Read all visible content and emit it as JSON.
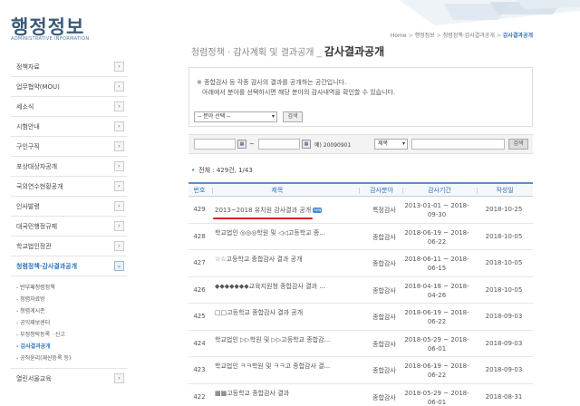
{
  "sidebar": {
    "title": "행정정보",
    "subtitle": "ADMINISTRATIVE INFORMATION",
    "items_top": [
      {
        "label": "정책자료"
      },
      {
        "label": "업무협약(MOU)"
      },
      {
        "label": "세소식"
      },
      {
        "label": "시험안내"
      },
      {
        "label": "구인구직"
      },
      {
        "label": "포상대상자공개"
      },
      {
        "label": "국외연수현황공개"
      },
      {
        "label": "인사발령"
      },
      {
        "label": "대국민행정규제"
      },
      {
        "label": "학교법인정관"
      }
    ],
    "active_item": {
      "label": "청렴정책·감사결과공개"
    },
    "submenu": [
      {
        "label": "- 반부패청렴정책"
      },
      {
        "label": "- 청렴자료방"
      },
      {
        "label": "- 청렴게시존"
      },
      {
        "label": "- 공익제보센터"
      },
      {
        "label": "- 부정청탁등록 · 신고"
      },
      {
        "label": "- 감사결과공개"
      },
      {
        "label": "- 공직윤리(재산등록 등)"
      }
    ],
    "active_sub_index": 5,
    "last_item": {
      "label": "열린서울교육"
    }
  },
  "breadcrumb": {
    "home": "Home",
    "level1": "행정정보",
    "level2": "청렴정책·감사결과공개",
    "current": "감사결과공개",
    "separator": ">"
  },
  "page": {
    "title_prefix": "청렴정책 · 감사계획 및 결과공개 _",
    "title": "감사결과공개"
  },
  "info": {
    "line1": "※ 종합감사 등 각종 감사의 결과를 공개하는 공간입니다.",
    "line2": "아래에서 분야를 선택하시면 해당 분야의 감사내역을 확인할 수 있습니다.",
    "select_value": "-- 분야 선택 --",
    "search_label": "검색"
  },
  "search_bar": {
    "date_from": "",
    "date_to": "",
    "tilde": "~",
    "example": "예) 20090901",
    "type_value": "제목",
    "keyword": "",
    "search_label": "검색"
  },
  "total": {
    "bullet": "•",
    "text": "전체 : 429건, 1/43"
  },
  "table": {
    "headers": [
      "번호",
      "제목",
      "감사분야",
      "감사기간",
      "작성일"
    ],
    "rows": [
      {
        "no": "429",
        "title": "2013~2018 유치원 감사결과 공개",
        "badge": "new",
        "field": "특정감사",
        "period_1": "2013-01-01 ~ 2018-",
        "period_2": "09-30",
        "date": "2018-10-25"
      },
      {
        "no": "428",
        "title": "학교법인 ◎◎◎학원 및 ◁◁고등학교 종...",
        "field": "종합감사",
        "period_1": "2018-06-19 ~ 2018-",
        "period_2": "06-22",
        "date": "2018-10-05"
      },
      {
        "no": "427",
        "title": "☆☆고등학교 종합감사 결과 공개",
        "field": "종합감사",
        "period_1": "2018-06-11 ~ 2018-",
        "period_2": "06-15",
        "date": "2018-10-05"
      },
      {
        "no": "426",
        "title": "◆◆◆◆◆◆◆교육지원청 종합감사 결과 ...",
        "field": "종합감사",
        "period_1": "2018-04-18 ~ 2018-",
        "period_2": "04-26",
        "date": "2018-10-05"
      },
      {
        "no": "425",
        "title": "□□고등학교 종합감사 결과 공개",
        "field": "종합감사",
        "period_1": "2018-06-19 ~ 2018-",
        "period_2": "06-22",
        "date": "2018-09-03"
      },
      {
        "no": "424",
        "title": "학교법인 ▷▷학원 및 ▷▷고등학교 종합감...",
        "field": "종합감사",
        "period_1": "2018-05-29 ~ 2018-",
        "period_2": "06-01",
        "date": "2018-09-03"
      },
      {
        "no": "423",
        "title": "학교법인 ㅋㅋ학원 및 ㅋㅋ고 종합감사 결...",
        "field": "종합감사",
        "period_1": "2018-06-19 ~ 2018-",
        "period_2": "06-22",
        "date": "2018-09-03"
      },
      {
        "no": "422",
        "title": "▩▩고등학교 종합감사 결과",
        "field": "종합감사",
        "period_1": "2018-05-29 ~ 2018-",
        "period_2": "06-01",
        "date": "2018-08-31"
      }
    ]
  },
  "icons": {
    "arrow_right": "›",
    "arrow_down": "⌄",
    "dropdown": "▾",
    "calendar": "▦"
  },
  "colors": {
    "accent": "#2f74bb",
    "underline": "#e02020",
    "title_blue": "#3a5a78"
  }
}
